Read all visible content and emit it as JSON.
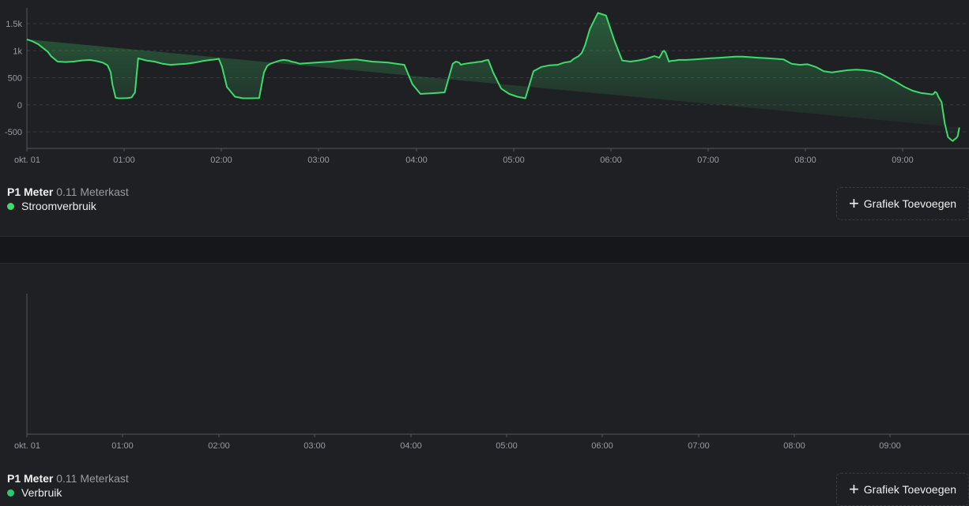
{
  "charts": [
    {
      "device": "P1 Meter",
      "zone": "0.11 Meterkast",
      "series_name": "Stroomverbruik",
      "series_color": "#3ddc6a",
      "add_button": "Grafiek Toevoegen",
      "add_icon": "plus-icon"
    },
    {
      "device": "P1 Meter",
      "zone": "0.11 Meterkast",
      "series_name": "Verbruik",
      "series_color": "#2ec96e",
      "add_button": "Grafiek Toevoegen",
      "add_icon": "plus-icon"
    }
  ],
  "chart_data": [
    {
      "type": "area",
      "title": "",
      "xlabel": "",
      "ylabel": "",
      "x_tick_labels": [
        "okt. 01",
        "01:00",
        "02:00",
        "03:00",
        "04:00",
        "05:00",
        "06:00",
        "07:00",
        "08:00",
        "09:00"
      ],
      "y_ticks": [
        -500,
        0,
        500,
        1000,
        1500
      ],
      "y_tick_labels": [
        "-500",
        "0",
        "500",
        "1k",
        "1.5k"
      ],
      "ylim": [
        -800,
        1750
      ],
      "xlim_minutes": [
        0,
        584
      ],
      "grid": true,
      "series": [
        {
          "name": "Stroomverbruik",
          "color": "#3ddc6a",
          "x_minutes": [
            0,
            3,
            7,
            10,
            13,
            15,
            19,
            24,
            29,
            34,
            39,
            43,
            47,
            50,
            52,
            53,
            55,
            57,
            59,
            62,
            64,
            65,
            67,
            69,
            74,
            79,
            84,
            89,
            94,
            99,
            104,
            109,
            114,
            117,
            119,
            121,
            124,
            129,
            134,
            139,
            144,
            147,
            149,
            151,
            154,
            157,
            159,
            162,
            164,
            167,
            169,
            174,
            179,
            184,
            189,
            194,
            199,
            204,
            209,
            214,
            219,
            224,
            229,
            234,
            239,
            244,
            249,
            254,
            259,
            264,
            266,
            268,
            269,
            270,
            272,
            274,
            277,
            279,
            282,
            284,
            286,
            289,
            294,
            299,
            304,
            309,
            314,
            319,
            324,
            329,
            331,
            333,
            337,
            339,
            342,
            344,
            346,
            349,
            354,
            359,
            364,
            369,
            374,
            379,
            384,
            389,
            392,
            393,
            394,
            395,
            396,
            397,
            398,
            399,
            402,
            404,
            409,
            414,
            419,
            424,
            429,
            434,
            439,
            444,
            449,
            454,
            459,
            464,
            469,
            474,
            479,
            484,
            489,
            494,
            499,
            504,
            509,
            514,
            519,
            524,
            529,
            534,
            539,
            544,
            549,
            554,
            559,
            561,
            562,
            563,
            564,
            565,
            567,
            569,
            571,
            573,
            574,
            575,
            576,
            577,
            578,
            579,
            580,
            581,
            582,
            584
          ],
          "values": [
            1210,
            1180,
            1120,
            1050,
            980,
            900,
            800,
            790,
            800,
            820,
            830,
            810,
            780,
            730,
            600,
            380,
            130,
            120,
            120,
            125,
            130,
            140,
            230,
            860,
            820,
            800,
            760,
            740,
            750,
            760,
            780,
            810,
            830,
            840,
            850,
            700,
            330,
            150,
            120,
            120,
            125,
            600,
            720,
            760,
            790,
            820,
            830,
            820,
            800,
            780,
            760,
            770,
            780,
            790,
            800,
            820,
            830,
            840,
            820,
            800,
            790,
            780,
            760,
            740,
            380,
            200,
            210,
            220,
            230,
            760,
            800,
            780,
            740,
            750,
            760,
            770,
            780,
            790,
            800,
            820,
            830,
            600,
            300,
            200,
            150,
            120,
            620,
            700,
            730,
            740,
            760,
            780,
            800,
            850,
            900,
            960,
            1100,
            1400,
            1700,
            1650,
            1200,
            820,
            800,
            820,
            850,
            900,
            870,
            920,
            980,
            1000,
            960,
            880,
            800,
            810,
            820,
            830,
            830,
            840,
            850,
            860,
            870,
            880,
            890,
            890,
            880,
            870,
            860,
            850,
            840,
            760,
            740,
            750,
            700,
            620,
            600,
            620,
            640,
            650,
            640,
            620,
            580,
            500,
            420,
            330,
            260,
            220,
            200,
            190,
            200,
            240,
            220,
            150,
            50,
            -350,
            -600,
            -650,
            -670,
            -640,
            -620,
            -580,
            -420
          ]
        }
      ]
    },
    {
      "type": "area",
      "title": "",
      "xlabel": "",
      "ylabel": "",
      "x_tick_labels": [
        "okt. 01",
        "01:00",
        "02:00",
        "03:00",
        "04:00",
        "05:00",
        "06:00",
        "07:00",
        "08:00",
        "09:00"
      ],
      "y_ticks": [],
      "y_tick_labels": [],
      "xlim_minutes": [
        0,
        584
      ],
      "grid": false,
      "series": [
        {
          "name": "Verbruik",
          "color": "#2ec96e",
          "x_minutes": [],
          "values": []
        }
      ]
    }
  ]
}
